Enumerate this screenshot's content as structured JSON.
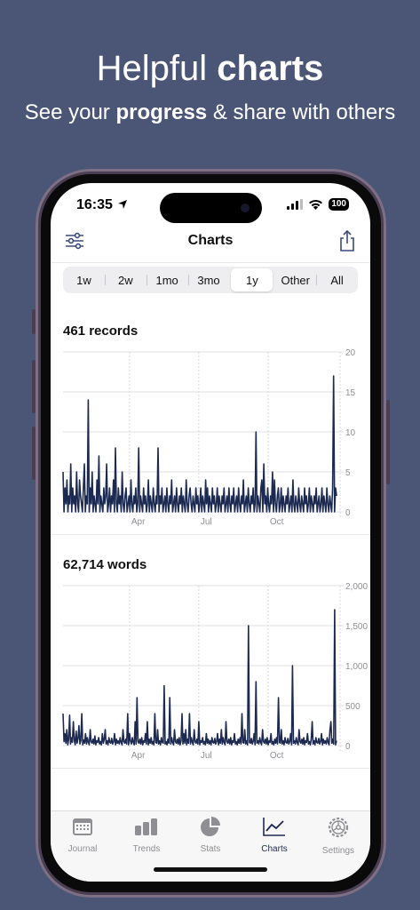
{
  "hero": {
    "title_regular": "Helpful ",
    "title_bold": "charts",
    "sub_pre": "See your ",
    "sub_bold": "progress",
    "sub_post": " & share with others"
  },
  "status_bar": {
    "time": "16:35",
    "battery": "100"
  },
  "navbar": {
    "title": "Charts",
    "left_icon": "sliders-icon",
    "right_icon": "share-icon"
  },
  "range_selector": {
    "options": [
      "1w",
      "2w",
      "1mo",
      "3mo",
      "1y",
      "Other",
      "All"
    ],
    "selected": "1y"
  },
  "charts": {
    "records_title": "461 records",
    "words_title": "62,714 words"
  },
  "chart_data": [
    {
      "type": "line",
      "title": "461 records",
      "x_tick_labels": [
        "Apr",
        "Jul",
        "Oct"
      ],
      "y_ticks": [
        0,
        5,
        10,
        15,
        20
      ],
      "ylim": [
        0,
        20
      ],
      "grid": true,
      "series": [
        {
          "values": [
            5,
            0,
            3,
            1,
            4,
            0,
            2,
            1,
            6,
            0,
            3,
            1,
            2,
            0,
            5,
            1,
            0,
            4,
            2,
            1,
            0,
            3,
            6,
            0,
            2,
            1,
            14,
            0,
            3,
            1,
            5,
            0,
            2,
            1,
            0,
            4,
            1,
            7,
            0,
            2,
            1,
            0,
            3,
            1,
            2,
            6,
            0,
            1,
            3,
            0,
            2,
            1,
            4,
            0,
            8,
            1,
            0,
            3,
            1,
            2,
            0,
            5,
            1,
            0,
            2,
            3,
            0,
            1,
            2,
            0,
            4,
            1,
            0,
            2,
            1,
            3,
            0,
            1,
            8,
            0,
            2,
            1,
            0,
            3,
            1,
            2,
            0,
            1,
            4,
            0,
            2,
            1,
            0,
            3,
            1,
            0,
            2,
            1,
            8,
            0,
            2,
            1,
            3,
            0,
            1,
            2,
            0,
            3,
            1,
            0,
            2,
            1,
            4,
            0,
            1,
            2,
            0,
            3,
            1,
            0,
            2,
            1,
            3,
            0,
            2,
            1,
            0,
            4,
            1,
            0,
            2,
            3,
            1,
            0,
            2,
            1,
            0,
            3,
            1,
            2,
            0,
            1,
            3,
            0,
            2,
            1,
            0,
            4,
            1,
            3,
            0,
            2,
            1,
            0,
            3,
            1,
            2,
            0,
            1,
            3,
            0,
            2,
            1,
            0,
            2,
            1,
            3,
            0,
            1,
            2,
            0,
            3,
            1,
            0,
            2,
            1,
            3,
            0,
            1,
            2,
            0,
            3,
            1,
            0,
            2,
            1,
            4,
            0,
            1,
            2,
            0,
            3,
            1,
            0,
            2,
            1,
            3,
            0,
            1,
            10,
            0,
            2,
            1,
            0,
            3,
            4,
            0,
            6,
            1,
            2,
            0,
            3,
            1,
            0,
            2,
            1,
            5,
            0,
            4,
            1,
            0,
            2,
            3,
            0,
            1,
            3,
            0,
            2,
            1,
            0,
            2,
            1,
            3,
            0,
            1,
            2,
            0,
            4,
            1,
            0,
            2,
            1,
            0,
            3,
            1,
            0,
            2,
            1,
            0,
            3,
            1,
            2,
            0,
            1,
            3,
            0,
            2,
            1,
            0,
            2,
            1,
            3,
            0,
            1,
            2,
            0,
            1,
            3,
            0,
            2,
            1,
            0,
            3,
            1,
            0,
            2,
            1,
            0,
            3,
            17,
            0,
            3,
            2
          ]
        }
      ]
    },
    {
      "type": "line",
      "title": "62,714 words",
      "x_tick_labels": [
        "Apr",
        "Jul",
        "Oct"
      ],
      "y_ticks": [
        0,
        500,
        1000,
        1500,
        2000
      ],
      "y_tick_labels": [
        "0",
        "500",
        "1,000",
        "1,500",
        "2,000"
      ],
      "ylim": [
        0,
        2000
      ],
      "grid": true,
      "series": [
        {
          "values": [
            400,
            50,
            150,
            30,
            200,
            10,
            80,
            380,
            20,
            100,
            40,
            300,
            60,
            10,
            180,
            30,
            90,
            250,
            20,
            60,
            400,
            10,
            70,
            30,
            150,
            20,
            100,
            40,
            10,
            200,
            50,
            30,
            80,
            20,
            120,
            10,
            60,
            40,
            100,
            20,
            50,
            10,
            150,
            30,
            80,
            200,
            20,
            60,
            10,
            100,
            40,
            30,
            90,
            20,
            50,
            150,
            10,
            80,
            30,
            60,
            20,
            100,
            40,
            10,
            200,
            50,
            30,
            80,
            20,
            400,
            10,
            150,
            60,
            20,
            100,
            40,
            10,
            300,
            20,
            600,
            50,
            30,
            80,
            20,
            100,
            10,
            60,
            40,
            150,
            20,
            300,
            10,
            80,
            30,
            100,
            20,
            50,
            10,
            400,
            40,
            30,
            200,
            20,
            60,
            10,
            100,
            40,
            30,
            750,
            20,
            50,
            10,
            80,
            30,
            600,
            20,
            100,
            40,
            10,
            200,
            50,
            30,
            80,
            20,
            100,
            10,
            60,
            400,
            20,
            150,
            30,
            200,
            10,
            80,
            30,
            400,
            20,
            100,
            40,
            10,
            200,
            50,
            30,
            80,
            20,
            300,
            10,
            60,
            40,
            100,
            20,
            50,
            10,
            150,
            30,
            80,
            20,
            60,
            10,
            100,
            40,
            30,
            90,
            20,
            50,
            150,
            10,
            80,
            30,
            200,
            20,
            100,
            40,
            10,
            300,
            50,
            30,
            80,
            20,
            100,
            10,
            60,
            40,
            150,
            20,
            50,
            10,
            80,
            30,
            100,
            20,
            400,
            40,
            30,
            200,
            20,
            60,
            10,
            1500,
            40,
            30,
            90,
            20,
            50,
            150,
            10,
            800,
            30,
            60,
            20,
            100,
            40,
            10,
            200,
            50,
            30,
            80,
            20,
            100,
            10,
            60,
            40,
            150,
            20,
            50,
            10,
            80,
            30,
            100,
            20,
            600,
            40,
            30,
            200,
            20,
            60,
            10,
            100,
            40,
            30,
            90,
            20,
            50,
            150,
            10,
            1000,
            30,
            60,
            20,
            100,
            40,
            10,
            200,
            50,
            30,
            80,
            20,
            100,
            10,
            60,
            40,
            150,
            20,
            50,
            10,
            80,
            300,
            20,
            60,
            10,
            100,
            40,
            30,
            90,
            20,
            50,
            150,
            10,
            80,
            30,
            60,
            20,
            100,
            40,
            10,
            200,
            300,
            30,
            80,
            20,
            1700,
            10,
            60
          ]
        }
      ]
    }
  ],
  "tabbar": {
    "items": [
      {
        "label": "Journal",
        "icon": "calendar-icon"
      },
      {
        "label": "Trends",
        "icon": "bar-chart-icon"
      },
      {
        "label": "Stats",
        "icon": "pie-chart-icon"
      },
      {
        "label": "Charts",
        "icon": "line-chart-icon"
      },
      {
        "label": "Settings",
        "icon": "gear-icon"
      }
    ],
    "active": "Charts"
  }
}
